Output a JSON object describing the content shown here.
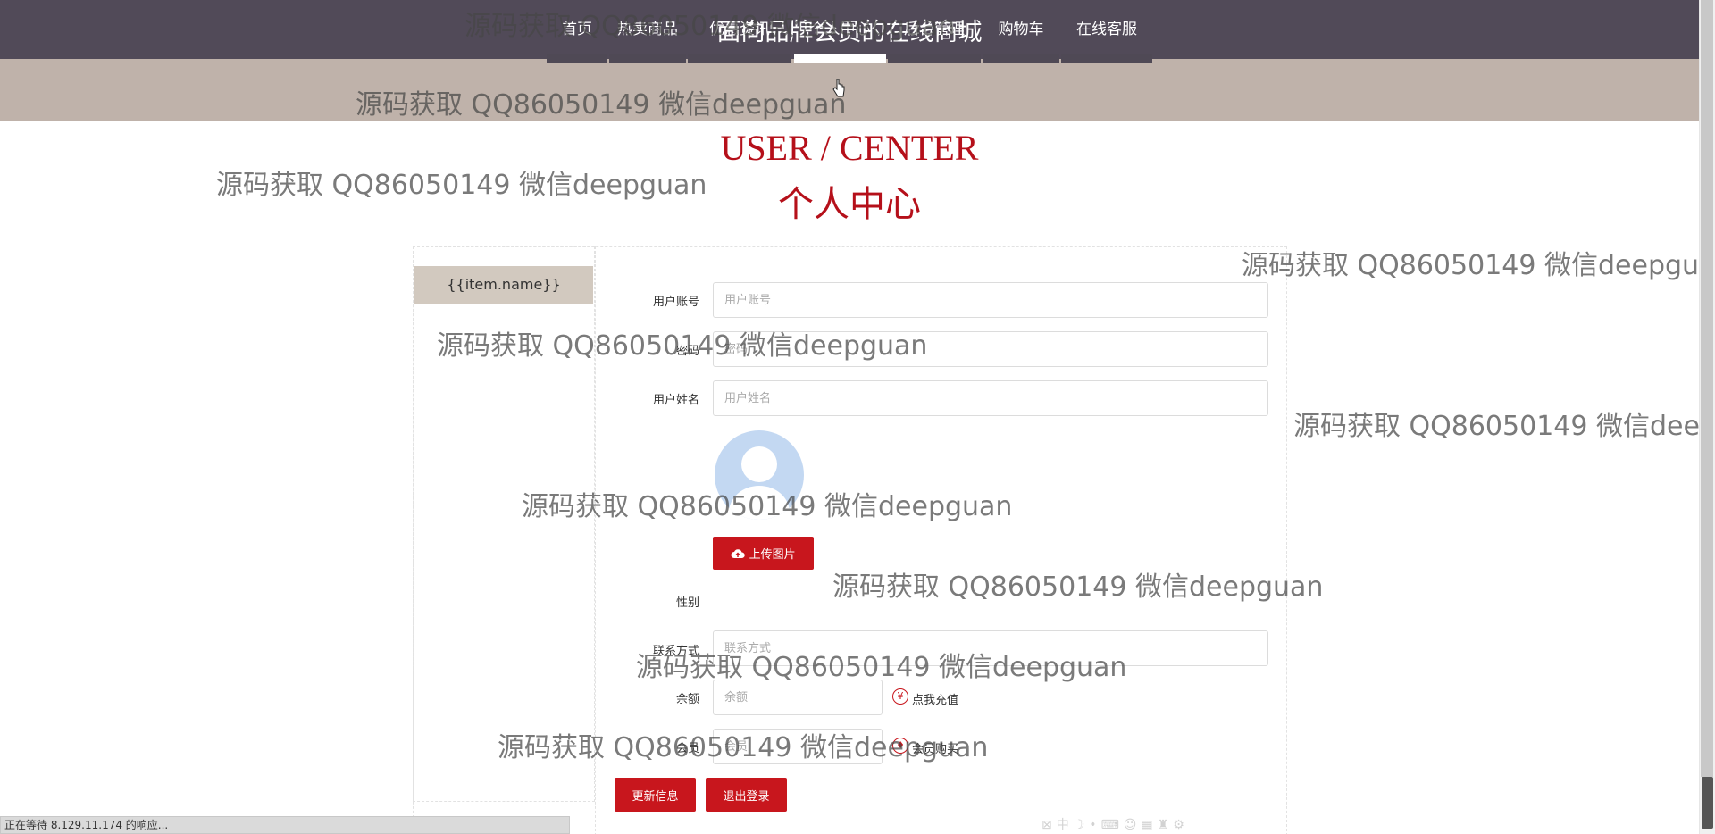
{
  "header": {
    "site_title": "面向品牌会员的在线商城"
  },
  "nav": {
    "items": [
      {
        "label": "首页"
      },
      {
        "label": "热卖商品"
      },
      {
        "label": "优惠资讯"
      },
      {
        "label": "个人中心",
        "active": true
      },
      {
        "label": "后台管理"
      },
      {
        "label": "购物车"
      },
      {
        "label": "在线客服"
      }
    ]
  },
  "hero": {
    "title_en": "USER / CENTER",
    "title_cn": "个人中心"
  },
  "sidebar": {
    "items": [
      {
        "label": "{{item.name}}"
      }
    ]
  },
  "form": {
    "username": {
      "label": "用户账号",
      "placeholder": "用户账号"
    },
    "password": {
      "label": "密码",
      "placeholder": "密码"
    },
    "fullname": {
      "label": "用户姓名",
      "placeholder": "用户姓名"
    },
    "upload_button": "上传图片",
    "gender": {
      "label": "性别"
    },
    "contact": {
      "label": "联系方式",
      "placeholder": "联系方式"
    },
    "balance": {
      "label": "余额",
      "placeholder": "余额",
      "link_icon": "¥",
      "link_label": "点我充值"
    },
    "member": {
      "label": "会员",
      "placeholder": "会员",
      "link_label": "会员购买"
    },
    "update_button": "更新信息",
    "logout_button": "退出登录"
  },
  "watermarks": [
    "源码获取 QQ86050149 微信deepguan",
    "源码获取 QQ86050149 微信deepguan",
    "源码获取 QQ86050149 微信deepguan",
    "源码获取 QQ86050149 微信deepguan",
    "源码获取 QQ86050149 微信deepguan",
    "源码获取 QQ86050149 微信deepguan",
    "源码获取 QQ86050149 微信deepguan",
    "源码获取 QQ86050149 微信deepguan",
    "源码获取 QQ86050149 微信deepguan",
    "源码获取 QQ86050149 微信deepguan"
  ],
  "status_bar": {
    "text": "正在等待 8.129.11.174 的响应..."
  },
  "ime_toolbar": {
    "text": "中"
  },
  "colors": {
    "header_bg": "#514a58",
    "nav_bg": "#bfb2aa",
    "accent_red": "#c8161d",
    "sidebar_item_bg": "#d2c9bf"
  }
}
